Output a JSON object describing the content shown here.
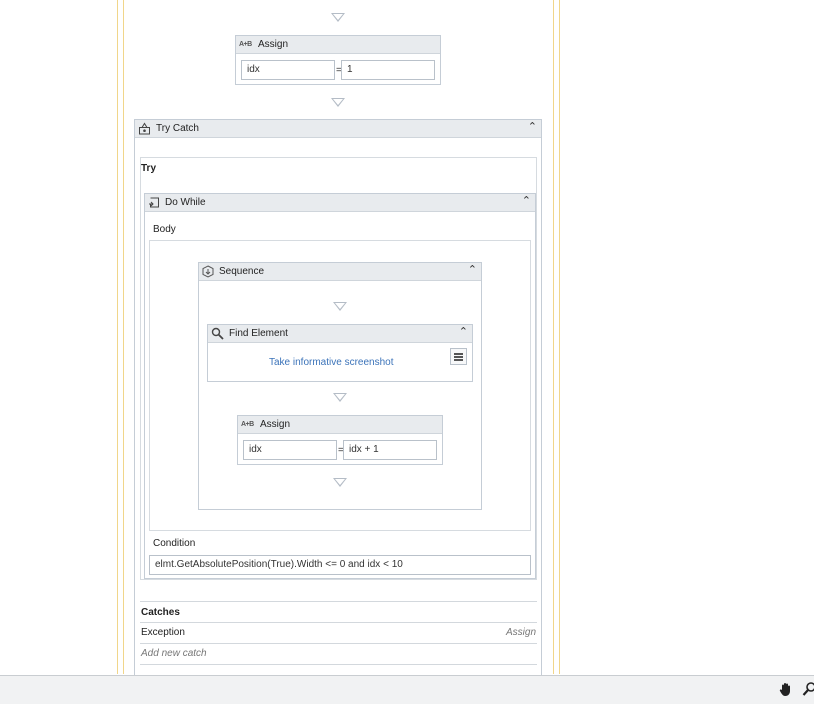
{
  "assign_top": {
    "title": "Assign",
    "to": "idx",
    "value": "1"
  },
  "try_catch": {
    "title": "Try Catch",
    "try_label": "Try"
  },
  "do_while": {
    "title": "Do While",
    "body_label": "Body",
    "condition_label": "Condition",
    "condition_value": "elmt.GetAbsolutePosition(True).Width <= 0 and idx < 10"
  },
  "sequence": {
    "title": "Sequence"
  },
  "find_element": {
    "title": "Find Element",
    "link": "Take informative screenshot"
  },
  "assign_inner": {
    "title": "Assign",
    "to": "idx",
    "value": "idx + 1"
  },
  "catches": {
    "header": "Catches",
    "exception_label": "Exception",
    "exception_action": "Assign",
    "add_new": "Add new catch"
  },
  "common": {
    "equals": "=",
    "assign_icon_text": "A+B"
  },
  "icons": {
    "collapse": "double-chevron-up-icon",
    "hand": "hand-pan-icon",
    "zoom": "magnifier-icon"
  },
  "colors": {
    "guide": "#f1d68a",
    "header": "#e8ebee",
    "link": "#3b73b9"
  }
}
